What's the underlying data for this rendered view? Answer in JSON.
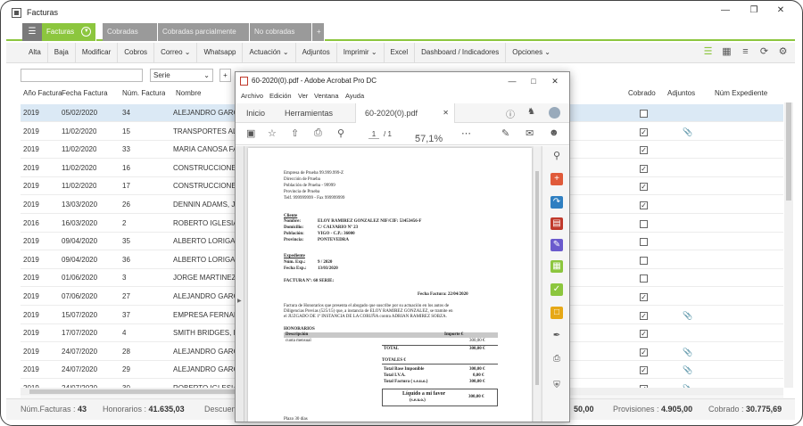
{
  "window": {
    "title": "Facturas"
  },
  "tabs": [
    {
      "label": "Facturas",
      "active": true
    },
    {
      "label": "Cobradas",
      "active": false
    },
    {
      "label": "Cobradas parcialmente",
      "active": false
    },
    {
      "label": "No cobradas",
      "active": false
    },
    {
      "label": "+",
      "active": false
    }
  ],
  "toolbar": {
    "items": [
      "Alta",
      "Baja",
      "Modificar",
      "Cobros",
      "Correo",
      "Whatsapp",
      "Actuación",
      "Adjuntos",
      "Imprimir",
      "Excel",
      "Dashboard / Indicadores",
      "Opciones"
    ]
  },
  "filters": {
    "serie_value": "Serie",
    "add": "+"
  },
  "table": {
    "columns": [
      "Año Factura",
      "Fecha Factura",
      "Núm. Factura",
      "Nombre",
      "Cobrado",
      "Adjuntos",
      "Núm Expediente"
    ],
    "rows": [
      {
        "year": "2019",
        "date": "05/02/2020",
        "num": "34",
        "name": "ALEJANDRO GARCIA",
        "cobrado": false,
        "adjunto": false,
        "sel": true
      },
      {
        "year": "2019",
        "date": "11/02/2020",
        "num": "15",
        "name": "TRANSPORTES ALTDE",
        "cobrado": true,
        "adjunto": true
      },
      {
        "year": "2019",
        "date": "11/02/2020",
        "num": "33",
        "name": "MARIA CANOSA FANI",
        "cobrado": true,
        "adjunto": false
      },
      {
        "year": "2019",
        "date": "11/02/2020",
        "num": "16",
        "name": "CONSTRUCCIONES F",
        "cobrado": true,
        "adjunto": false
      },
      {
        "year": "2019",
        "date": "11/02/2020",
        "num": "17",
        "name": "CONSTRUCCIONES F",
        "cobrado": true,
        "adjunto": false
      },
      {
        "year": "2019",
        "date": "13/03/2020",
        "num": "26",
        "name": "DENNIN ADAMS, JON",
        "cobrado": true,
        "adjunto": false
      },
      {
        "year": "2016",
        "date": "16/03/2020",
        "num": "2",
        "name": "ROBERTO IGLESIAS C",
        "cobrado": false,
        "adjunto": false
      },
      {
        "year": "2019",
        "date": "09/04/2020",
        "num": "35",
        "name": "ALBERTO LORIGA VE",
        "cobrado": false,
        "adjunto": false
      },
      {
        "year": "2019",
        "date": "09/04/2020",
        "num": "36",
        "name": "ALBERTO LORIGA VE",
        "cobrado": false,
        "adjunto": false
      },
      {
        "year": "2019",
        "date": "01/06/2020",
        "num": "3",
        "name": "JORGE MARTINEZ DI",
        "cobrado": false,
        "adjunto": false
      },
      {
        "year": "2019",
        "date": "07/06/2020",
        "num": "27",
        "name": "ALEJANDRO GARCIA",
        "cobrado": true,
        "adjunto": false
      },
      {
        "year": "2019",
        "date": "15/07/2020",
        "num": "37",
        "name": "EMPRESA FERNANDE",
        "cobrado": true,
        "adjunto": true
      },
      {
        "year": "2019",
        "date": "17/07/2020",
        "num": "4",
        "name": "SMITH BRIDGES, PAU",
        "cobrado": true,
        "adjunto": false
      },
      {
        "year": "2019",
        "date": "24/07/2020",
        "num": "28",
        "name": "ALEJANDRO GARCIA",
        "cobrado": true,
        "adjunto": true
      },
      {
        "year": "2019",
        "date": "24/07/2020",
        "num": "29",
        "name": "ALEJANDRO GARCIA",
        "cobrado": true,
        "adjunto": true
      },
      {
        "year": "2019",
        "date": "24/07/2020",
        "num": "30",
        "name": "ROBERTO IGLESIAS",
        "cobrado": true,
        "adjunto": true
      }
    ]
  },
  "footer": {
    "num_facturas_label": "Núm.Facturas :",
    "num_facturas": "43",
    "honorarios_label": "Honorarios :",
    "honorarios": "41.635,03",
    "descuento_label": "Descuento",
    "gastos_value": "50,00",
    "provisiones_label": "Provisiones :",
    "provisiones": "4.905,00",
    "cobrado_label": "Cobrado :",
    "cobrado": "30.775,69"
  },
  "acrobat": {
    "title": "60-2020(0).pdf - Adobe Acrobat Pro DC",
    "menu": [
      "Archivo",
      "Edición",
      "Ver",
      "Ventana",
      "Ayuda"
    ],
    "tab_home": "Inicio",
    "tab_tools": "Herramientas",
    "tab_doc": "60-2020(0).pdf",
    "page_current": "1",
    "page_total": "/ 1",
    "zoom": "57,1%",
    "pdf": {
      "company": [
        "Empresa de Prueba 99.999.999-Z",
        "Dirección de Prueba",
        "Población de Prueba - 99999",
        "Provincia de Prueba",
        "Telf. 999999999 - Fax 999999999"
      ],
      "cliente_title": "Cliente",
      "cliente": [
        "Nombre:",
        "ELOY RAMIREZ GONZALEZ NIF/CIF: 53453456-F",
        "Domicilio:",
        "C/ CALVARIO Nº 23",
        "Población:",
        "VIGO - C.P.: 36000",
        "Provincia:",
        "PONTEVEDRA"
      ],
      "expediente_title": "Expediente",
      "expediente": [
        "Núm. Exp.:",
        "9 / 2020",
        "Fecha Exp.:",
        "13/03/2020"
      ],
      "factura": "FACTURA Nº: 60 SERIE:",
      "fecha_factura": "Fecha Factura: 22/04/2020",
      "texto": [
        "Factura de Honorarios que presenta el abogado que suscribe por su actuación en los autos de",
        "Diligencias Previas  (525/15) que, a instancia de ELOY RAMIREZ GONZALEZ, se tramite en",
        "el JUZGADO DE 1ª INSTANCIA DE LA CORUÑA contra ADRIAN RAMIREZ SOBZA."
      ],
      "honorarios": "HONORARIOS",
      "tabla_head": [
        "Descripción",
        "Importe €"
      ],
      "tabla_row": [
        "cuota mensual",
        "300,00 €"
      ],
      "total_label": "TOTAL",
      "total": "300,00 €",
      "totales_label": "TOTALES €",
      "totales": [
        [
          "Total Base Imponible",
          "300,00 €"
        ],
        [
          "Total I.V.A.",
          "0,00 €"
        ],
        [
          "Total Factura ( s.e.u.o.)",
          "300,00 €"
        ]
      ],
      "liquido_label": "Líquido a mi favor",
      "liquido_sub": "(s.e.u.o.)",
      "liquido": "300,00 €",
      "plazo": "Plazo 30 días"
    }
  }
}
